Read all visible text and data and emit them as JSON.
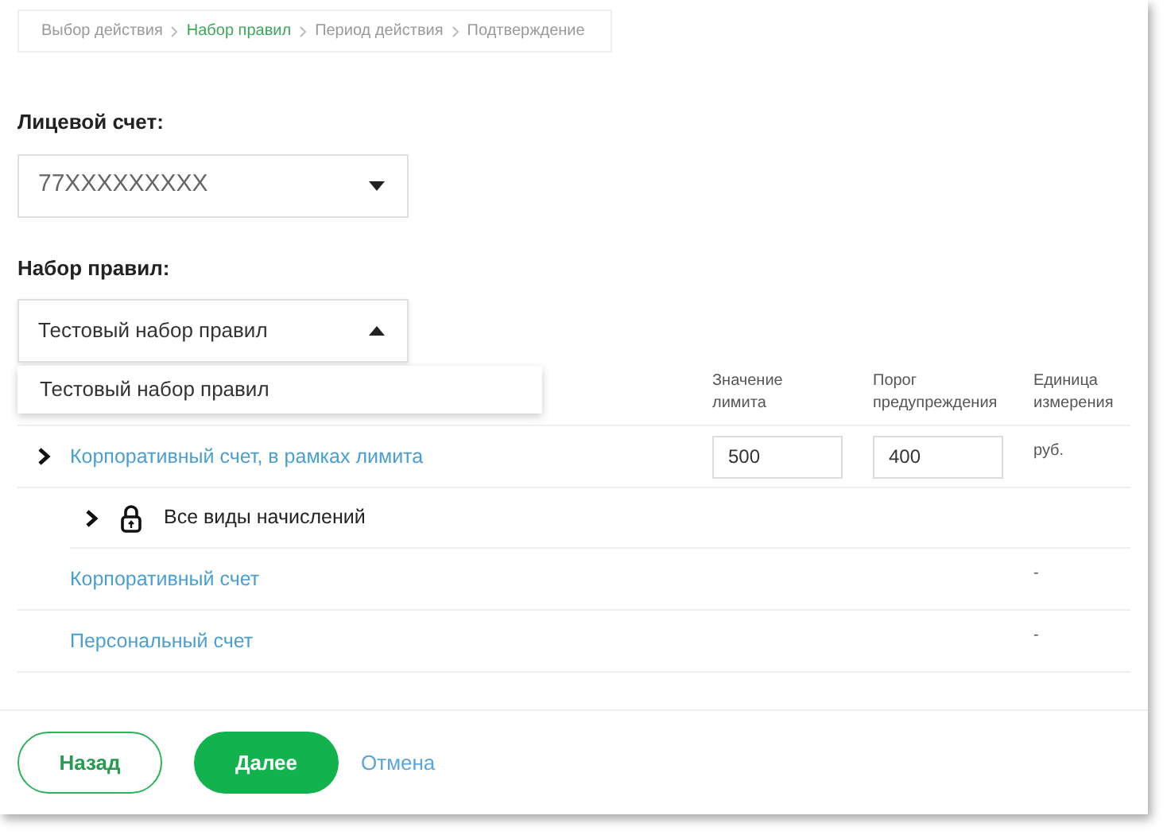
{
  "breadcrumb": [
    {
      "label": "Выбор действия",
      "selected": false
    },
    {
      "label": "Набор правил",
      "selected": true
    },
    {
      "label": "Период действия",
      "selected": false
    },
    {
      "label": "Подтверждение",
      "selected": false
    }
  ],
  "account": {
    "label": "Лицевой счет:",
    "value": "77XXXXXXXXX",
    "expanded": false
  },
  "ruleset": {
    "label": "Набор правил:",
    "value": "Тестовый набор правил",
    "expanded": true,
    "options": [
      "Тестовый набор правил"
    ]
  },
  "table": {
    "columns": [
      "Значение лимита",
      "Порог предупреждения",
      "Единица измерения"
    ],
    "rows": [
      {
        "label": "Корпоративный счет, в рамках лимита",
        "expandable": true,
        "limit": "500",
        "threshold": "400",
        "unit": "руб.",
        "children": [
          {
            "label": "Все виды начислений",
            "expandable": true,
            "locked": true
          }
        ]
      },
      {
        "label": "Корпоративный счет",
        "expandable": false,
        "unit": "-"
      },
      {
        "label": "Персональный счет",
        "expandable": false,
        "unit": "-"
      }
    ]
  },
  "buttons": {
    "back": "Назад",
    "next": "Далее",
    "cancel": "Отмена"
  }
}
